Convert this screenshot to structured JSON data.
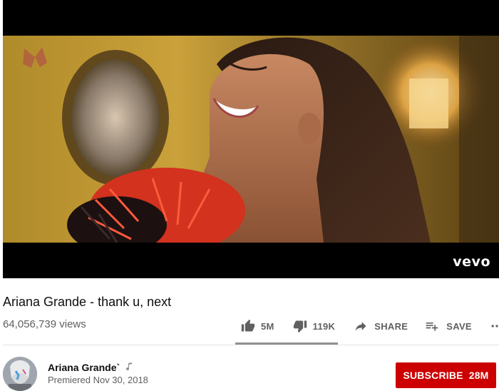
{
  "player": {
    "watermark": "vevo"
  },
  "video": {
    "title": "Ariana Grande - thank u, next",
    "views": "64,056,739 views"
  },
  "actions": {
    "like_count": "5M",
    "dislike_count": "119K",
    "share_label": "SHARE",
    "save_label": "SAVE",
    "like_ratio": 0.977
  },
  "channel": {
    "name": "Ariana Grande`",
    "premiered": "Premiered Nov 30, 2018",
    "subscribe_label": "SUBSCRIBE",
    "subscriber_count": "28M"
  },
  "icons": {
    "like": "thumbs-up-icon",
    "dislike": "thumbs-down-icon",
    "share": "share-arrow-icon",
    "save": "playlist-add-icon",
    "more": "more-horizontal-icon",
    "channel_badge": "music-note-icon"
  },
  "colors": {
    "subscribe_bg": "#cc0000",
    "secondary_text": "#606060",
    "player_bg": "#000000"
  }
}
